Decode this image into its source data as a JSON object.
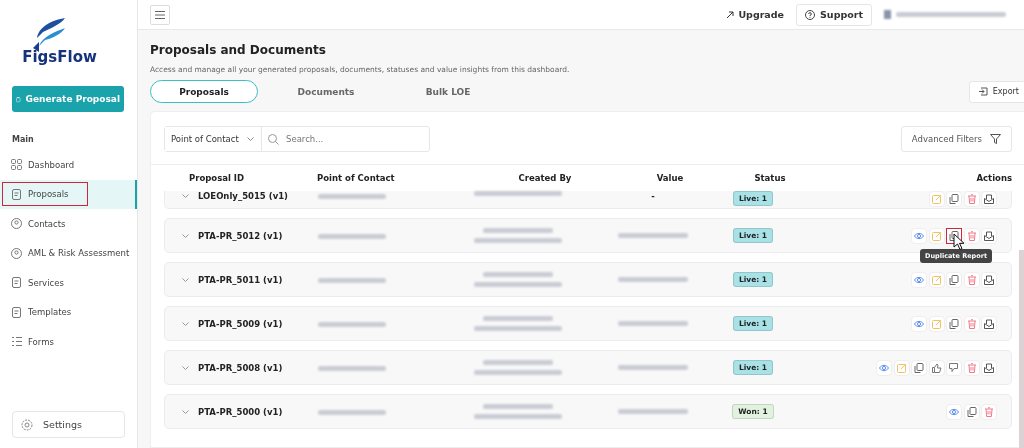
{
  "sidebar": {
    "logo": "FigsFlow",
    "primary_button": "Generate Proposal",
    "section": "Main",
    "items": [
      {
        "label": "Dashboard",
        "selected": false,
        "outlined": false
      },
      {
        "label": "Proposals",
        "selected": true,
        "outlined": true
      },
      {
        "label": "Contacts",
        "selected": false,
        "outlined": false
      },
      {
        "label": "AML & Risk Assessment",
        "selected": false,
        "outlined": false
      },
      {
        "label": "Services",
        "selected": false,
        "outlined": false
      },
      {
        "label": "Templates",
        "selected": false,
        "outlined": false
      },
      {
        "label": "Forms",
        "selected": false,
        "outlined": false
      }
    ],
    "settings": "Settings"
  },
  "topbar": {
    "upgrade": "Upgrade",
    "support": "Support"
  },
  "page": {
    "title": "Proposals and Documents",
    "subtitle": "Access and manage all your generated proposals, documents, statuses and value insights from this dashboard.",
    "export": "Export"
  },
  "tabs": [
    {
      "label": "Proposals",
      "selected": true
    },
    {
      "label": "Documents",
      "selected": false
    },
    {
      "label": "Bulk LOE",
      "selected": false
    }
  ],
  "filters": {
    "dropdown": "Point of Contact",
    "search_placeholder": "Search...",
    "advanced": "Advanced Filters"
  },
  "table": {
    "columns": [
      "Proposal ID",
      "Point of Contact",
      "Created By",
      "Value",
      "Status",
      "Actions"
    ],
    "rows": [
      {
        "id": "LOEOnly_5015 (v1)",
        "value": "-",
        "status": {
          "label": "Live: 1",
          "color": "#a8e2e6"
        },
        "actions": [
          {
            "kind": "edit",
            "hovered": false
          },
          {
            "kind": "copy",
            "hovered": false
          },
          {
            "kind": "delete",
            "hovered": false
          },
          {
            "kind": "send",
            "hovered": false
          }
        ]
      },
      {
        "id": "PTA-PR_5012 (v1)",
        "status": {
          "label": "Live: 1",
          "color": "#a8e2e6"
        },
        "actions": [
          {
            "kind": "view",
            "hovered": false
          },
          {
            "kind": "edit",
            "hovered": false
          },
          {
            "kind": "copy",
            "hovered": true,
            "tooltip": "Duplicate Report"
          },
          {
            "kind": "delete",
            "hovered": false
          },
          {
            "kind": "send",
            "hovered": false
          }
        ]
      },
      {
        "id": "PTA-PR_5011 (v1)",
        "status": {
          "label": "Live: 1",
          "color": "#a8e2e6"
        },
        "actions": [
          {
            "kind": "view",
            "hovered": false
          },
          {
            "kind": "edit",
            "hovered": false
          },
          {
            "kind": "copy",
            "hovered": false
          },
          {
            "kind": "delete",
            "hovered": false
          },
          {
            "kind": "send",
            "hovered": false
          }
        ]
      },
      {
        "id": "PTA-PR_5009 (v1)",
        "status": {
          "label": "Live: 1",
          "color": "#a8e2e6"
        },
        "actions": [
          {
            "kind": "view",
            "hovered": false
          },
          {
            "kind": "edit",
            "hovered": false
          },
          {
            "kind": "copy",
            "hovered": false
          },
          {
            "kind": "delete",
            "hovered": false
          },
          {
            "kind": "send",
            "hovered": false
          }
        ]
      },
      {
        "id": "PTA-PR_5008 (v1)",
        "status": {
          "label": "Live: 1",
          "color": "#a8e2e6"
        },
        "actions": [
          {
            "kind": "view",
            "hovered": false
          },
          {
            "kind": "edit",
            "hovered": false
          },
          {
            "kind": "copy",
            "hovered": false
          },
          {
            "kind": "like",
            "hovered": false
          },
          {
            "kind": "dislike",
            "hovered": false
          },
          {
            "kind": "delete",
            "hovered": false
          },
          {
            "kind": "send",
            "hovered": false
          }
        ]
      },
      {
        "id": "PTA-PR_5000 (v1)",
        "status": {
          "label": "Won: 1",
          "color": "#e1f3df"
        },
        "actions": [
          {
            "kind": "view",
            "hovered": false
          },
          {
            "kind": "copy",
            "hovered": false
          },
          {
            "kind": "delete",
            "hovered": false
          }
        ]
      }
    ]
  }
}
